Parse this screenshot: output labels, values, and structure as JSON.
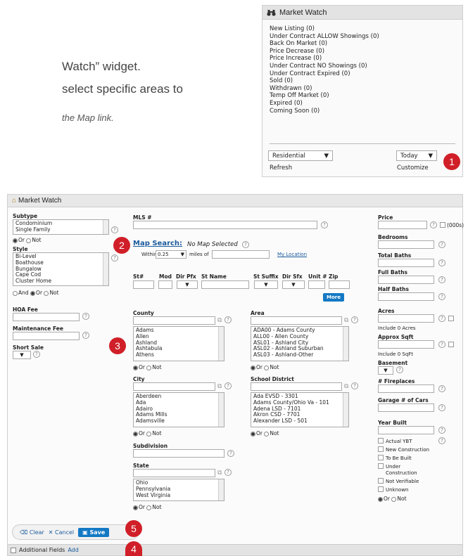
{
  "instructions": {
    "line1": "Watch” widget.",
    "line2": "select specific areas to",
    "line3": "the Map link."
  },
  "widget": {
    "title": "Market Watch",
    "items": [
      "New Listing (0)",
      "Under Contract ALLOW Showings (0)",
      "Back On Market (0)",
      "Price Decrease (0)",
      "Price Increase (0)",
      "Under Contract NO Showings (0)",
      "Under Contract Expired (0)",
      "Sold (0)",
      "Withdrawn (0)",
      "Temp Off Market (0)",
      "Expired (0)",
      "Coming Soon (0)"
    ],
    "property_type": "Residential",
    "period": "Today",
    "refresh": "Refresh",
    "customize": "Customize"
  },
  "badges": [
    "1",
    "2",
    "3",
    "4",
    "5"
  ],
  "form": {
    "title": "Market Watch",
    "subtype": {
      "label": "Subtype",
      "options": [
        "Condominium",
        "Single Family"
      ]
    },
    "style": {
      "label": "Style",
      "options": [
        "Bi-Level",
        "Boathouse",
        "Bungalow",
        "Cape Cod",
        "Cluster Home"
      ]
    },
    "or": "Or",
    "not": "Not",
    "and": "And",
    "hoa_fee": "HOA Fee",
    "maintenance_fee": "Maintenance Fee",
    "short_sale": "Short Sale",
    "mls": "MLS #",
    "map_search": "Map Search:",
    "no_map": "No Map Selected",
    "within": "Within",
    "miles_value": "0.25",
    "miles_of": "miles of",
    "my_location": "My Location",
    "address_labels": [
      "St#",
      "Mod",
      "Dir Pfx",
      "St Name",
      "St Suffix",
      "Dir Sfx",
      "Unit #",
      "Zip"
    ],
    "more": "More",
    "county": {
      "label": "County",
      "options": [
        "Adams",
        "Allen",
        "Ashland",
        "Ashtabula",
        "Athens"
      ]
    },
    "area": {
      "label": "Area",
      "options": [
        "ADA00 - Adams County",
        "ALL00 - Allen County",
        "ASL01 - Ashland City",
        "ASL02 - Ashland Suburban",
        "ASL03 - Ashland-Other"
      ]
    },
    "city": {
      "label": "City",
      "options": [
        "Aberdeen",
        "Ada",
        "Adairo",
        "Adams Mills",
        "Adamsville"
      ]
    },
    "school_district": {
      "label": "School District",
      "options": [
        "Ada EVSD - 3301",
        "Adams County/Ohio Va - 101",
        "Adena LSD - 7101",
        "Akron CSD - 7701",
        "Alexander LSD - 501"
      ]
    },
    "subdivision": "Subdivision",
    "state": {
      "label": "State",
      "options": [
        "Ohio",
        "Pennsylvania",
        "West Virginia"
      ]
    },
    "price": "Price",
    "price_unit": "(000s)",
    "bedrooms": "Bedrooms",
    "total_baths": "Total Baths",
    "full_baths": "Full Baths",
    "half_baths": "Half Baths",
    "acres": "Acres",
    "include_acres": "Include 0 Acres",
    "approx_sqft": "Approx Sqft",
    "include_sqft": "Include 0 SqFt",
    "basement": "Basement",
    "fireplaces": "# Fireplaces",
    "garage": "Garage # of Cars",
    "year_built": "Year Built",
    "year_options": [
      "Actual YBT",
      "New Construction",
      "To Be Built",
      "Under Construction",
      "Not Verifiable",
      "Unknown"
    ],
    "clear": "Clear",
    "cancel": "Cancel",
    "save": "Save",
    "additional_fields": "Additional Fields",
    "add": "Add"
  },
  "colors": {
    "badge": "#d01f28",
    "link": "#1a5a9e",
    "button": "#1479c4"
  }
}
